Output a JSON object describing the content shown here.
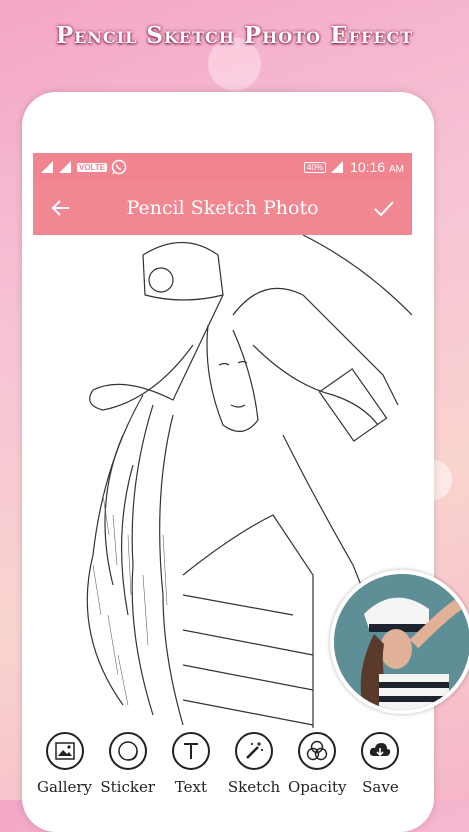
{
  "headline": "Pencil Sketch Photo Effect",
  "status_bar": {
    "volte": "VOLTE",
    "battery": "40%",
    "time": "10:16",
    "ampm": "AM"
  },
  "toolbar": {
    "title": "Pencil Sketch Photo",
    "back_icon": "arrow-left-icon",
    "confirm_icon": "check-icon"
  },
  "tools": [
    {
      "label": "Gallery",
      "icon": "gallery-icon"
    },
    {
      "label": "Sticker",
      "icon": "sticker-icon"
    },
    {
      "label": "Text",
      "icon": "text-icon"
    },
    {
      "label": "Sketch",
      "icon": "magic-wand-icon"
    },
    {
      "label": "Opacity",
      "icon": "opacity-icon"
    },
    {
      "label": "Save",
      "icon": "download-icon"
    }
  ],
  "colors": {
    "accent": "#f08791",
    "status_bar": "#f2848f"
  }
}
